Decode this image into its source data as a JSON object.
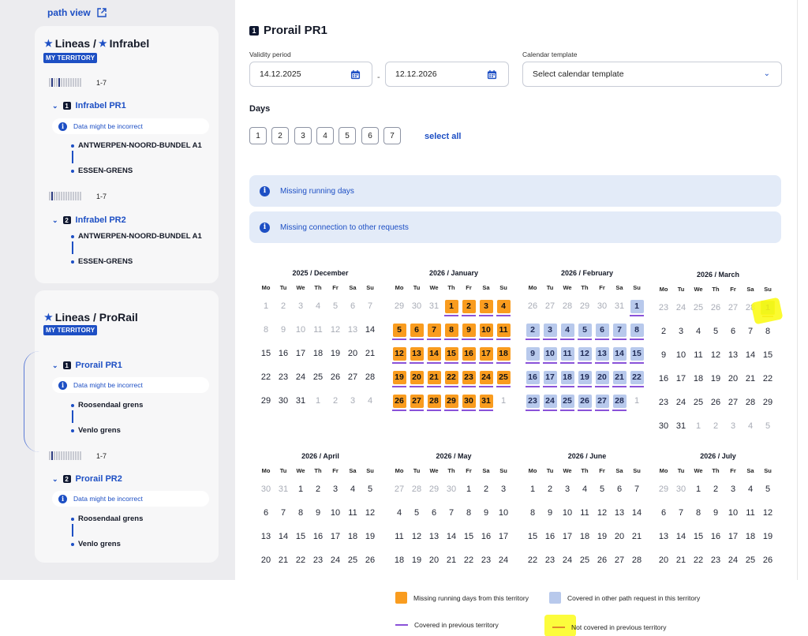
{
  "sidebar": {
    "path_view": "path view",
    "cards": [
      {
        "title_left": "Lineas /",
        "title_right": "Infrabel",
        "badge": "MY TERRITORY",
        "requests": [
          {
            "range": "1-7",
            "num": "1",
            "title": "Infrabel PR1",
            "warning": "Data might be incorrect",
            "from": "ANTWERPEN-NOORD-BUNDEL A1",
            "to": "ESSEN-GRENS"
          },
          {
            "range": "1-7",
            "num": "2",
            "title": "Infrabel PR2",
            "warning": "",
            "from": "ANTWERPEN-NOORD-BUNDEL A1",
            "to": "ESSEN-GRENS"
          }
        ]
      },
      {
        "title_left": "Lineas / ProRail",
        "badge": "MY TERRITORY",
        "requests": [
          {
            "range": "",
            "num": "1",
            "title": "Prorail PR1",
            "warning": "Data might be incorrect",
            "from": "Roosendaal grens",
            "to": "Venlo grens"
          },
          {
            "range": "1-7",
            "num": "2",
            "title": "Prorail PR2",
            "warning": "Data might be incorrect",
            "from": "Roosendaal grens",
            "to": "Venlo grens"
          }
        ]
      }
    ]
  },
  "main": {
    "num": "1",
    "title": "Prorail PR1",
    "validity_label": "Validity period",
    "date_from": "14.12.2025",
    "date_to": "12.12.2026",
    "dash": "-",
    "template_label": "Calendar template",
    "template_placeholder": "Select calendar template",
    "days_title": "Days",
    "days": [
      "1",
      "2",
      "3",
      "4",
      "5",
      "6",
      "7"
    ],
    "select_all": "select all",
    "banners": [
      "Missing running days",
      "Missing connection to other requests"
    ]
  },
  "weekdays": [
    "Mo",
    "Tu",
    "We",
    "Th",
    "Fr",
    "Sa",
    "Su"
  ],
  "calendar": [
    {
      "title": "2025 / December",
      "cells": [
        [
          "1",
          "o"
        ],
        [
          "2",
          "o"
        ],
        [
          "3",
          "o"
        ],
        [
          "4",
          "o"
        ],
        [
          "5",
          "o"
        ],
        [
          "6",
          "o"
        ],
        [
          "7",
          "o"
        ],
        [
          "8",
          "o"
        ],
        [
          "9",
          "o"
        ],
        [
          "10",
          "o"
        ],
        [
          "11",
          "o"
        ],
        [
          "12",
          "o"
        ],
        [
          "13",
          "o"
        ],
        [
          "14",
          ""
        ],
        [
          "15",
          ""
        ],
        [
          "16",
          ""
        ],
        [
          "17",
          ""
        ],
        [
          "18",
          ""
        ],
        [
          "19",
          ""
        ],
        [
          "20",
          ""
        ],
        [
          "21",
          ""
        ],
        [
          "22",
          ""
        ],
        [
          "23",
          ""
        ],
        [
          "24",
          ""
        ],
        [
          "25",
          ""
        ],
        [
          "26",
          ""
        ],
        [
          "27",
          ""
        ],
        [
          "28",
          ""
        ],
        [
          "29",
          ""
        ],
        [
          "30",
          ""
        ],
        [
          "31",
          ""
        ],
        [
          "1",
          "o"
        ],
        [
          "2",
          "o"
        ],
        [
          "3",
          "o"
        ],
        [
          "4",
          "o"
        ]
      ]
    },
    {
      "title": "2026 / January",
      "cells": [
        [
          "29",
          "o"
        ],
        [
          "30",
          "o"
        ],
        [
          "31",
          "o"
        ],
        [
          "1",
          "m"
        ],
        [
          "2",
          "m"
        ],
        [
          "3",
          "m"
        ],
        [
          "4",
          "m"
        ],
        [
          "5",
          "m"
        ],
        [
          "6",
          "m"
        ],
        [
          "7",
          "m"
        ],
        [
          "8",
          "m"
        ],
        [
          "9",
          "m"
        ],
        [
          "10",
          "m"
        ],
        [
          "11",
          "m"
        ],
        [
          "12",
          "m"
        ],
        [
          "13",
          "m"
        ],
        [
          "14",
          "m"
        ],
        [
          "15",
          "m"
        ],
        [
          "16",
          "m"
        ],
        [
          "17",
          "m"
        ],
        [
          "18",
          "m"
        ],
        [
          "19",
          "m"
        ],
        [
          "20",
          "m"
        ],
        [
          "21",
          "m"
        ],
        [
          "22",
          "m"
        ],
        [
          "23",
          "m"
        ],
        [
          "24",
          "m"
        ],
        [
          "25",
          "m"
        ],
        [
          "26",
          "m"
        ],
        [
          "27",
          "m"
        ],
        [
          "28",
          "m"
        ],
        [
          "29",
          "m"
        ],
        [
          "30",
          "m"
        ],
        [
          "31",
          "m"
        ],
        [
          "1",
          "o"
        ]
      ]
    },
    {
      "title": "2026 / February",
      "cells": [
        [
          "26",
          "o"
        ],
        [
          "27",
          "o"
        ],
        [
          "28",
          "o"
        ],
        [
          "29",
          "o"
        ],
        [
          "30",
          "o"
        ],
        [
          "31",
          "o"
        ],
        [
          "1",
          "c"
        ],
        [
          "2",
          "c"
        ],
        [
          "3",
          "c"
        ],
        [
          "4",
          "c"
        ],
        [
          "5",
          "c"
        ],
        [
          "6",
          "c"
        ],
        [
          "7",
          "c"
        ],
        [
          "8",
          "c"
        ],
        [
          "9",
          "c"
        ],
        [
          "10",
          "c"
        ],
        [
          "11",
          "c"
        ],
        [
          "12",
          "c"
        ],
        [
          "13",
          "c"
        ],
        [
          "14",
          "c"
        ],
        [
          "15",
          "c"
        ],
        [
          "16",
          "c"
        ],
        [
          "17",
          "c"
        ],
        [
          "18",
          "c"
        ],
        [
          "19",
          "c"
        ],
        [
          "20",
          "c"
        ],
        [
          "21",
          "c"
        ],
        [
          "22",
          "c"
        ],
        [
          "23",
          "c"
        ],
        [
          "24",
          "c"
        ],
        [
          "25",
          "c"
        ],
        [
          "26",
          "c"
        ],
        [
          "27",
          "c"
        ],
        [
          "28",
          "c"
        ],
        [
          "1",
          "o"
        ]
      ]
    },
    {
      "title": "2026 / March",
      "cells": [
        [
          "23",
          "o"
        ],
        [
          "24",
          "o"
        ],
        [
          "25",
          "o"
        ],
        [
          "26",
          "o"
        ],
        [
          "27",
          "o"
        ],
        [
          "28",
          "o"
        ],
        [
          "1",
          "n"
        ],
        [
          "2",
          ""
        ],
        [
          "3",
          ""
        ],
        [
          "4",
          ""
        ],
        [
          "5",
          ""
        ],
        [
          "6",
          ""
        ],
        [
          "7",
          ""
        ],
        [
          "8",
          ""
        ],
        [
          "9",
          ""
        ],
        [
          "10",
          ""
        ],
        [
          "11",
          ""
        ],
        [
          "12",
          ""
        ],
        [
          "13",
          ""
        ],
        [
          "14",
          ""
        ],
        [
          "15",
          ""
        ],
        [
          "16",
          ""
        ],
        [
          "17",
          ""
        ],
        [
          "18",
          ""
        ],
        [
          "19",
          ""
        ],
        [
          "20",
          ""
        ],
        [
          "21",
          ""
        ],
        [
          "22",
          ""
        ],
        [
          "23",
          ""
        ],
        [
          "24",
          ""
        ],
        [
          "25",
          ""
        ],
        [
          "26",
          ""
        ],
        [
          "27",
          ""
        ],
        [
          "28",
          ""
        ],
        [
          "29",
          ""
        ],
        [
          "30",
          ""
        ],
        [
          "31",
          ""
        ],
        [
          "1",
          "o"
        ],
        [
          "2",
          "o"
        ],
        [
          "3",
          "o"
        ],
        [
          "4",
          "o"
        ],
        [
          "5",
          "o"
        ]
      ]
    },
    {
      "title": "2026 / April",
      "cells": [
        [
          "30",
          "o"
        ],
        [
          "31",
          "o"
        ],
        [
          "1",
          ""
        ],
        [
          "2",
          ""
        ],
        [
          "3",
          ""
        ],
        [
          "4",
          ""
        ],
        [
          "5",
          ""
        ],
        [
          "6",
          ""
        ],
        [
          "7",
          ""
        ],
        [
          "8",
          ""
        ],
        [
          "9",
          ""
        ],
        [
          "10",
          ""
        ],
        [
          "11",
          ""
        ],
        [
          "12",
          ""
        ],
        [
          "13",
          ""
        ],
        [
          "14",
          ""
        ],
        [
          "15",
          ""
        ],
        [
          "16",
          ""
        ],
        [
          "17",
          ""
        ],
        [
          "18",
          ""
        ],
        [
          "19",
          ""
        ],
        [
          "20",
          ""
        ],
        [
          "21",
          ""
        ],
        [
          "22",
          ""
        ],
        [
          "23",
          ""
        ],
        [
          "24",
          ""
        ],
        [
          "25",
          ""
        ],
        [
          "26",
          ""
        ]
      ]
    },
    {
      "title": "2026 / May",
      "cells": [
        [
          "27",
          "o"
        ],
        [
          "28",
          "o"
        ],
        [
          "29",
          "o"
        ],
        [
          "30",
          "o"
        ],
        [
          "1",
          ""
        ],
        [
          "2",
          ""
        ],
        [
          "3",
          ""
        ],
        [
          "4",
          ""
        ],
        [
          "5",
          ""
        ],
        [
          "6",
          ""
        ],
        [
          "7",
          ""
        ],
        [
          "8",
          ""
        ],
        [
          "9",
          ""
        ],
        [
          "10",
          ""
        ],
        [
          "11",
          ""
        ],
        [
          "12",
          ""
        ],
        [
          "13",
          ""
        ],
        [
          "14",
          ""
        ],
        [
          "15",
          ""
        ],
        [
          "16",
          ""
        ],
        [
          "17",
          ""
        ],
        [
          "18",
          ""
        ],
        [
          "19",
          ""
        ],
        [
          "20",
          ""
        ],
        [
          "21",
          ""
        ],
        [
          "22",
          ""
        ],
        [
          "23",
          ""
        ],
        [
          "24",
          ""
        ]
      ]
    },
    {
      "title": "2026 / June",
      "cells": [
        [
          "1",
          ""
        ],
        [
          "2",
          ""
        ],
        [
          "3",
          ""
        ],
        [
          "4",
          ""
        ],
        [
          "5",
          ""
        ],
        [
          "6",
          ""
        ],
        [
          "7",
          ""
        ],
        [
          "8",
          ""
        ],
        [
          "9",
          ""
        ],
        [
          "10",
          ""
        ],
        [
          "11",
          ""
        ],
        [
          "12",
          ""
        ],
        [
          "13",
          ""
        ],
        [
          "14",
          ""
        ],
        [
          "15",
          ""
        ],
        [
          "16",
          ""
        ],
        [
          "17",
          ""
        ],
        [
          "18",
          ""
        ],
        [
          "19",
          ""
        ],
        [
          "20",
          ""
        ],
        [
          "21",
          ""
        ],
        [
          "22",
          ""
        ],
        [
          "23",
          ""
        ],
        [
          "24",
          ""
        ],
        [
          "25",
          ""
        ],
        [
          "26",
          ""
        ],
        [
          "27",
          ""
        ],
        [
          "28",
          ""
        ]
      ]
    },
    {
      "title": "2026 / July",
      "cells": [
        [
          "29",
          "o"
        ],
        [
          "30",
          "o"
        ],
        [
          "1",
          ""
        ],
        [
          "2",
          ""
        ],
        [
          "3",
          ""
        ],
        [
          "4",
          ""
        ],
        [
          "5",
          ""
        ],
        [
          "6",
          ""
        ],
        [
          "7",
          ""
        ],
        [
          "8",
          ""
        ],
        [
          "9",
          ""
        ],
        [
          "10",
          ""
        ],
        [
          "11",
          ""
        ],
        [
          "12",
          ""
        ],
        [
          "13",
          ""
        ],
        [
          "14",
          ""
        ],
        [
          "15",
          ""
        ],
        [
          "16",
          ""
        ],
        [
          "17",
          ""
        ],
        [
          "18",
          ""
        ],
        [
          "19",
          ""
        ],
        [
          "20",
          ""
        ],
        [
          "21",
          ""
        ],
        [
          "22",
          ""
        ],
        [
          "23",
          ""
        ],
        [
          "24",
          ""
        ],
        [
          "25",
          ""
        ],
        [
          "26",
          ""
        ]
      ]
    }
  ],
  "legend": {
    "missing": "Missing running days from this territory",
    "covered": "Covered in other path request in this territory",
    "covered_prev": "Covered in previous territory",
    "not_covered_prev": "Not covered in previous territory",
    "colors": {
      "missing": "#f99c1f",
      "covered": "#b8c9ec",
      "covered_prev": "#8a52d9",
      "not_covered_prev": "#e08a2a"
    }
  }
}
